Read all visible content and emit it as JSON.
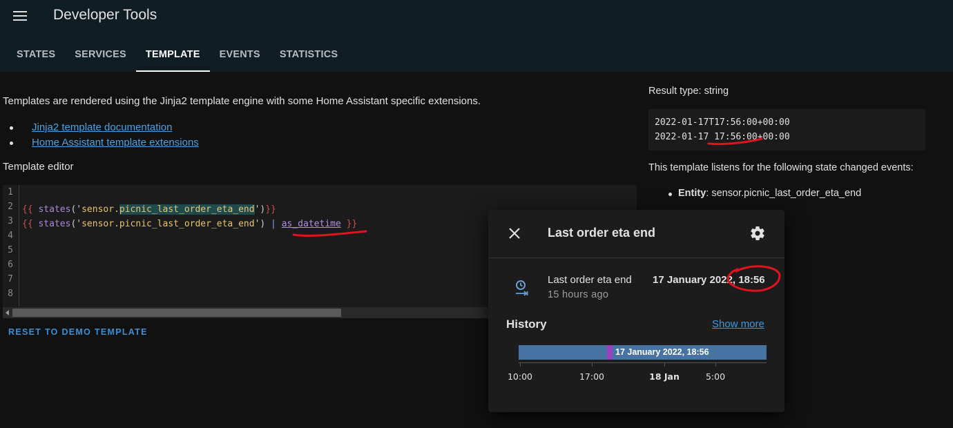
{
  "header": {
    "title": "Developer Tools",
    "tabs": [
      {
        "label": "STATES"
      },
      {
        "label": "SERVICES"
      },
      {
        "label": "TEMPLATE"
      },
      {
        "label": "EVENTS"
      },
      {
        "label": "STATISTICS"
      }
    ],
    "active_tab": "TEMPLATE"
  },
  "main": {
    "intro": "Templates are rendered using the Jinja2 template engine with some Home Assistant specific extensions.",
    "links": [
      {
        "label": "Jinja2 template documentation"
      },
      {
        "label": "Home Assistant template extensions"
      }
    ],
    "editor_label": "Template editor",
    "editor": {
      "line_numbers": [
        "1",
        "2",
        "3",
        "4",
        "5",
        "6",
        "7",
        "8"
      ],
      "line2": {
        "open": "{{",
        "fn": "states",
        "paren_open": "('",
        "str_a": "sensor.",
        "str_b": "picnic_last_order_eta_end",
        "paren_close": "')",
        "close": "}}"
      },
      "line3": {
        "open": "{{",
        "fn": "states",
        "paren_open": "('",
        "str": "sensor.picnic_last_order_eta_end",
        "paren_close": "')",
        "pipe": "|",
        "filter": "as_datetime",
        "close": "}}"
      }
    },
    "reset_button": "RESET TO DEMO TEMPLATE"
  },
  "result": {
    "type_label": "Result type: string",
    "lines": [
      "2022-01-17T17:56:00+00:00",
      "2022-01-17 17:56:00+00:00"
    ],
    "listens_text": "This template listens for the following state changed events:",
    "entity_label": "Entity",
    "entity_sep": ":",
    "entity_value": "sensor.picnic_last_order_eta_end"
  },
  "dialog": {
    "title": "Last order eta end",
    "entity_name": "Last order eta end",
    "last_changed": "15 hours ago",
    "state": "17 January 2022, 18:56",
    "history_label": "History",
    "show_more": "Show more",
    "timeline": {
      "state_label": "17 January 2022, 18:56",
      "ticks": [
        {
          "label": "10:00",
          "bold": false
        },
        {
          "label": "17:00",
          "bold": false
        },
        {
          "label": "18 Jan",
          "bold": true
        },
        {
          "label": "5:00",
          "bold": false
        }
      ],
      "colors": {
        "bar": "#4673a1",
        "marker": "#9b3fbd"
      }
    }
  },
  "colors": {
    "header_bg": "#101e24",
    "page_bg": "#111111",
    "link": "#4aa3e4",
    "accent": "#3d8fd1",
    "annotation": "#e0141e"
  }
}
